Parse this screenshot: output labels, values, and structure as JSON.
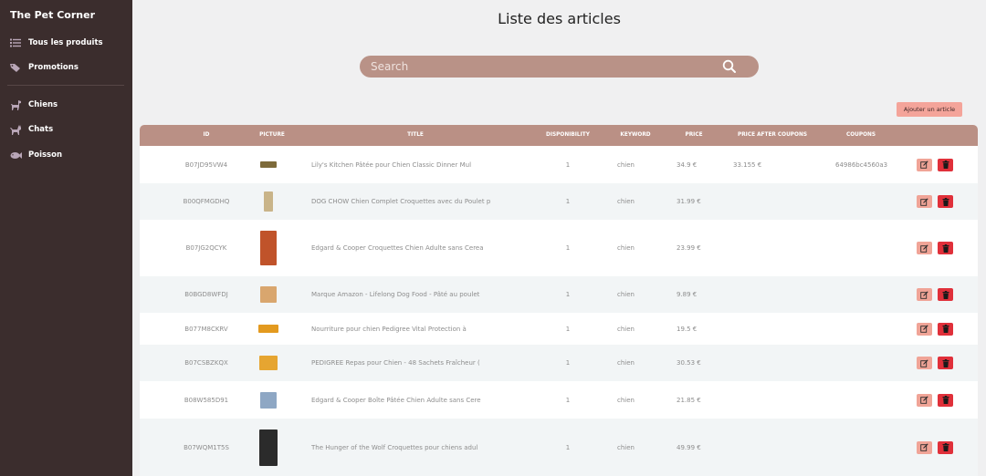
{
  "sidebar": {
    "brand": "The Pet Corner",
    "items": [
      {
        "label": "Tous les produits",
        "icon": "list-icon"
      },
      {
        "label": "Promotions",
        "icon": "tag-icon"
      },
      {
        "label": "Chiens",
        "icon": "dog-icon"
      },
      {
        "label": "Chats",
        "icon": "cat-icon"
      },
      {
        "label": "Poisson",
        "icon": "fish-icon"
      }
    ]
  },
  "main": {
    "title": "Liste des articles",
    "search": {
      "placeholder": "Search",
      "value": ""
    },
    "add_button": "Ajouter un article"
  },
  "table": {
    "columns": [
      "ID",
      "PICTURE",
      "TITLE",
      "DISPONIBILITY",
      "KEYWORD",
      "PRICE",
      "PRICE AFTER COUPONS",
      "COUPONS"
    ],
    "rows": [
      {
        "id": "B07JD95VW4",
        "title": "Lily's Kitchen Pâtée pour Chien Classic Dinner Mul",
        "dispo": "1",
        "keyword": "chien",
        "price": "34.9 €",
        "price_after": "33.155 €",
        "coupons": "64986bc4560a3",
        "thumb_color": "#7d6a3a"
      },
      {
        "id": "B00QFMGDHQ",
        "title": "DOG CHOW Chien Complet Croquettes avec du Poulet p",
        "dispo": "1",
        "keyword": "chien",
        "price": "31.99 €",
        "price_after": "",
        "coupons": "",
        "thumb_color": "#c9b489"
      },
      {
        "id": "B07JG2QCYK",
        "title": "Edgard & Cooper Croquettes Chien Adulte sans Cerea",
        "dispo": "1",
        "keyword": "chien",
        "price": "23.99 €",
        "price_after": "",
        "coupons": "",
        "thumb_color": "#c0532a"
      },
      {
        "id": "B0BGD8WFDJ",
        "title": "Marque Amazon - Lifelong Dog Food - Pâté au poulet",
        "dispo": "1",
        "keyword": "chien",
        "price": "9.89 €",
        "price_after": "",
        "coupons": "",
        "thumb_color": "#d9a66e"
      },
      {
        "id": "B077M8CKRV",
        "title": "Nourriture pour chien Pedigree Vital Protection à",
        "dispo": "1",
        "keyword": "chien",
        "price": "19.5 €",
        "price_after": "",
        "coupons": "",
        "thumb_color": "#e39a1f"
      },
      {
        "id": "B07CSBZKQX",
        "title": "PEDIGREE Repas pour Chien - 48 Sachets Fraîcheur (",
        "dispo": "1",
        "keyword": "chien",
        "price": "30.53 €",
        "price_after": "",
        "coupons": "",
        "thumb_color": "#e6a531"
      },
      {
        "id": "B08W585D91",
        "title": "Edgard & Cooper Boîte Pâtée Chien Adulte sans Cere",
        "dispo": "1",
        "keyword": "chien",
        "price": "21.85 €",
        "price_after": "",
        "coupons": "",
        "thumb_color": "#8ea7c4"
      },
      {
        "id": "B07WQM1T5S",
        "title": "The Hunger of the Wolf Croquettes pour chiens adul",
        "dispo": "1",
        "keyword": "chien",
        "price": "49.99 €",
        "price_after": "",
        "coupons": "",
        "thumb_color": "#2b2b2b"
      }
    ]
  },
  "colors": {
    "sidebar_bg": "#3b2d2d",
    "header_bg": "#ba9085",
    "search_bg": "#b99287",
    "edit_btn": "#f0a497",
    "delete_btn": "#e0303a"
  }
}
